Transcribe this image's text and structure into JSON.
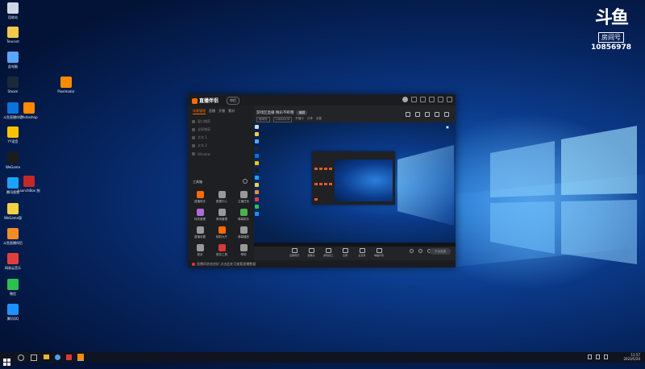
{
  "watermark": {
    "logo": "斗鱼",
    "room_label": "房间号",
    "room_number": "10856978"
  },
  "desktop_icons": [
    {
      "label": "回收站",
      "color": "#cfd8e3"
    },
    {
      "label": "Tencent",
      "color": "#f2c94c"
    },
    {
      "label": "此电脑",
      "color": "#58a6ff"
    },
    {
      "label": "Steam",
      "color": "#1b2838"
    },
    {
      "label": "斗鱼直播伴侣",
      "color": "#0a74da"
    },
    {
      "label": "YY语音",
      "color": "#f7c500"
    },
    {
      "label": "WeGame",
      "color": "#1c1c1c"
    },
    {
      "label": "腾讯视频",
      "color": "#1ba4ff"
    },
    {
      "label": "WeGame版",
      "color": "#f2d243"
    },
    {
      "label": "斗鱼直播伴侣",
      "color": "#f28c28"
    },
    {
      "label": "网易云音乐",
      "color": "#e13f3f"
    },
    {
      "label": "微信",
      "color": "#2ec04f"
    },
    {
      "label": "腾讯QQ",
      "color": "#1e90ff"
    },
    {
      "label": "Pixelmator",
      "color": "#ff8a00"
    },
    {
      "label": "Photoshop",
      "color": "#ff8a00"
    },
    {
      "label": "LaunchBox 快捷方式",
      "color": "#c62828"
    }
  ],
  "app": {
    "brand": "直播伴侣",
    "brand_tag": "伴侣",
    "left_tabs": [
      "场景管理",
      "直播",
      "开播",
      "素材"
    ],
    "sources": [
      "窗口捕获",
      "全屏捕获",
      "文本 1",
      "文本 2",
      "Window"
    ],
    "tools_title": "工具箱",
    "tools": [
      {
        "label": "直播助手",
        "color": "#ff6a00"
      },
      {
        "label": "数据中心",
        "color": "#999999"
      },
      {
        "label": "主播任务",
        "color": "#999999"
      },
      {
        "label": "特效管理",
        "color": "#b06bd6"
      },
      {
        "label": "房间管理",
        "color": "#999999"
      },
      {
        "label": "弹幕助手",
        "color": "#4caf50"
      },
      {
        "label": "直播设置",
        "color": "#999999"
      },
      {
        "label": "相机大厅",
        "color": "#ff6a00"
      },
      {
        "label": "弹幕播放",
        "color": "#999999"
      },
      {
        "label": "更多",
        "color": "#999999"
      },
      {
        "label": "更多工具",
        "color": "#d63a3a"
      },
      {
        "label": "帮助",
        "color": "#999999"
      }
    ],
    "room_title": "游戏区直播 精彩不断哦",
    "room_pill": "编辑",
    "room_sub": [
      "房间号",
      "10856978",
      "开播中",
      "分享",
      "设置"
    ],
    "controls": [
      "直播场景",
      "摄像头",
      "游戏窗口",
      "全屏",
      "麦克风",
      "电脑声音"
    ],
    "start_button": "开始直播",
    "status_text": "直播间状态良好 点击此处可查看直播数据"
  },
  "tray": {
    "time": "11:57",
    "date": "2023/5/20"
  }
}
